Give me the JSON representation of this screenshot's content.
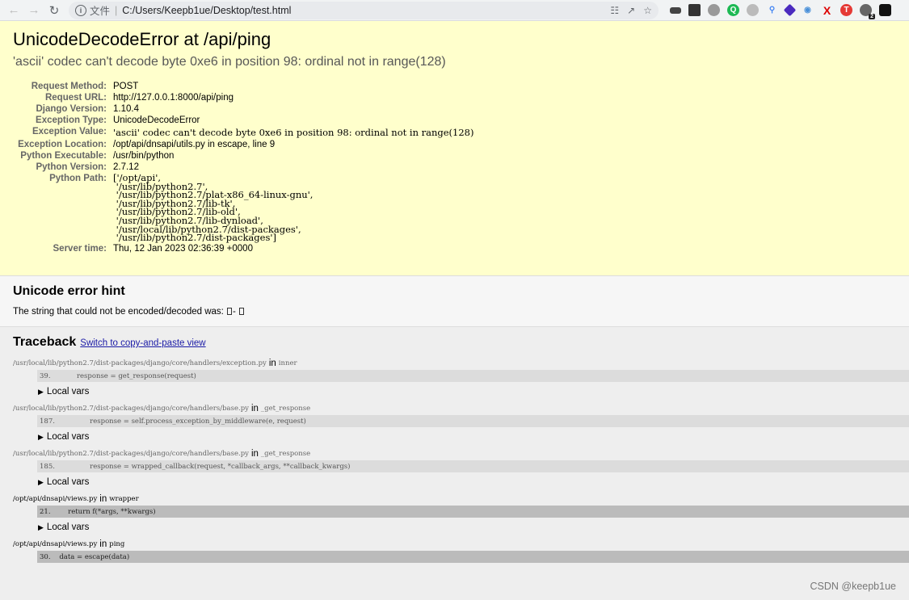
{
  "browser": {
    "scheme_label": "文件",
    "url": "C:/Users/Keepb1ue/Desktop/test.html",
    "ext_badge": "2"
  },
  "summary": {
    "title": "UnicodeDecodeError at /api/ping",
    "exception_value": "'ascii' codec can't decode byte 0xe6 in position 98: ordinal not in range(128)",
    "meta": [
      {
        "label": "Request Method:",
        "value": "POST"
      },
      {
        "label": "Request URL:",
        "value": "http://127.0.0.1:8000/api/ping"
      },
      {
        "label": "Django Version:",
        "value": "1.10.4"
      },
      {
        "label": "Exception Type:",
        "value": "UnicodeDecodeError"
      },
      {
        "label": "Exception Value:",
        "value": "'ascii' codec can't decode byte 0xe6 in position 98: ordinal not in range(128)"
      },
      {
        "label": "Exception Location:",
        "value": "/opt/api/dnsapi/utils.py in escape, line 9"
      },
      {
        "label": "Python Executable:",
        "value": "/usr/bin/python"
      },
      {
        "label": "Python Version:",
        "value": "2.7.12"
      },
      {
        "label": "Python Path:",
        "value": "['/opt/api',\n '/usr/lib/python2.7',\n '/usr/lib/python2.7/plat-x86_64-linux-gnu',\n '/usr/lib/python2.7/lib-tk',\n '/usr/lib/python2.7/lib-old',\n '/usr/lib/python2.7/lib-dynload',\n '/usr/local/lib/python2.7/dist-packages',\n '/usr/lib/python2.7/dist-packages']"
      },
      {
        "label": "Server time:",
        "value": "Thu, 12 Jan 2023 02:36:39 +0000"
      }
    ]
  },
  "unicode_hint": {
    "heading": "Unicode error hint",
    "text": "The string that could not be encoded/decoded was: ",
    "mid": "- "
  },
  "traceback": {
    "heading": "Traceback",
    "switch_link": "Switch to copy-and-paste view",
    "in_word": "in",
    "local_vars_label": "Local vars",
    "frames": [
      {
        "file": "/usr/local/lib/python2.7/dist-packages/django/core/handlers/exception.py",
        "func": "inner",
        "lineno": "39.",
        "code": "            response = get_response(request)"
      },
      {
        "file": "/usr/local/lib/python2.7/dist-packages/django/core/handlers/base.py",
        "func": "_get_response",
        "lineno": "187.",
        "code": "                response = self.process_exception_by_middleware(e, request)"
      },
      {
        "file": "/usr/local/lib/python2.7/dist-packages/django/core/handlers/base.py",
        "func": "_get_response",
        "lineno": "185.",
        "code": "                response = wrapped_callback(request, *callback_args, **callback_kwargs)"
      },
      {
        "file": "/opt/api/dnsapi/views.py",
        "func": "wrapper",
        "lineno": "21.",
        "code": "        return f(*args, **kwargs)"
      },
      {
        "file": "/opt/api/dnsapi/views.py",
        "func": "ping",
        "lineno": "30.",
        "code": "    data = escape(data)"
      }
    ]
  },
  "watermark": "CSDN @keepb1ue"
}
